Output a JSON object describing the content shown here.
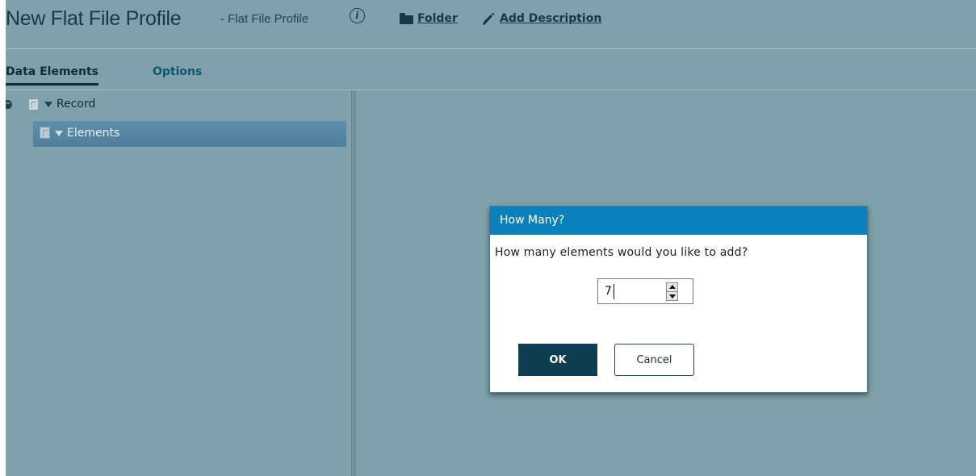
{
  "header": {
    "title": "New Flat File Profile",
    "subtitle": "- Flat File Profile",
    "info_icon": "info-icon",
    "folder_link": "Folder",
    "description_link": "Add Description"
  },
  "tabs": [
    {
      "label": "Data Elements",
      "active": true
    },
    {
      "label": "Options",
      "active": false
    }
  ],
  "tree": {
    "nodes": [
      {
        "label": "Record",
        "expanded": true,
        "selected": false
      },
      {
        "label": "Elements",
        "expanded": true,
        "selected": true
      }
    ]
  },
  "dialog": {
    "title": "How Many?",
    "question": "How many elements would you like to add?",
    "value": "7",
    "ok_label": "OK",
    "cancel_label": "Cancel"
  },
  "colors": {
    "background": "#80a0ab",
    "dialog_header": "#0a7fba",
    "ok_button": "#0f3d52",
    "selected_row": "#5a89a6"
  }
}
